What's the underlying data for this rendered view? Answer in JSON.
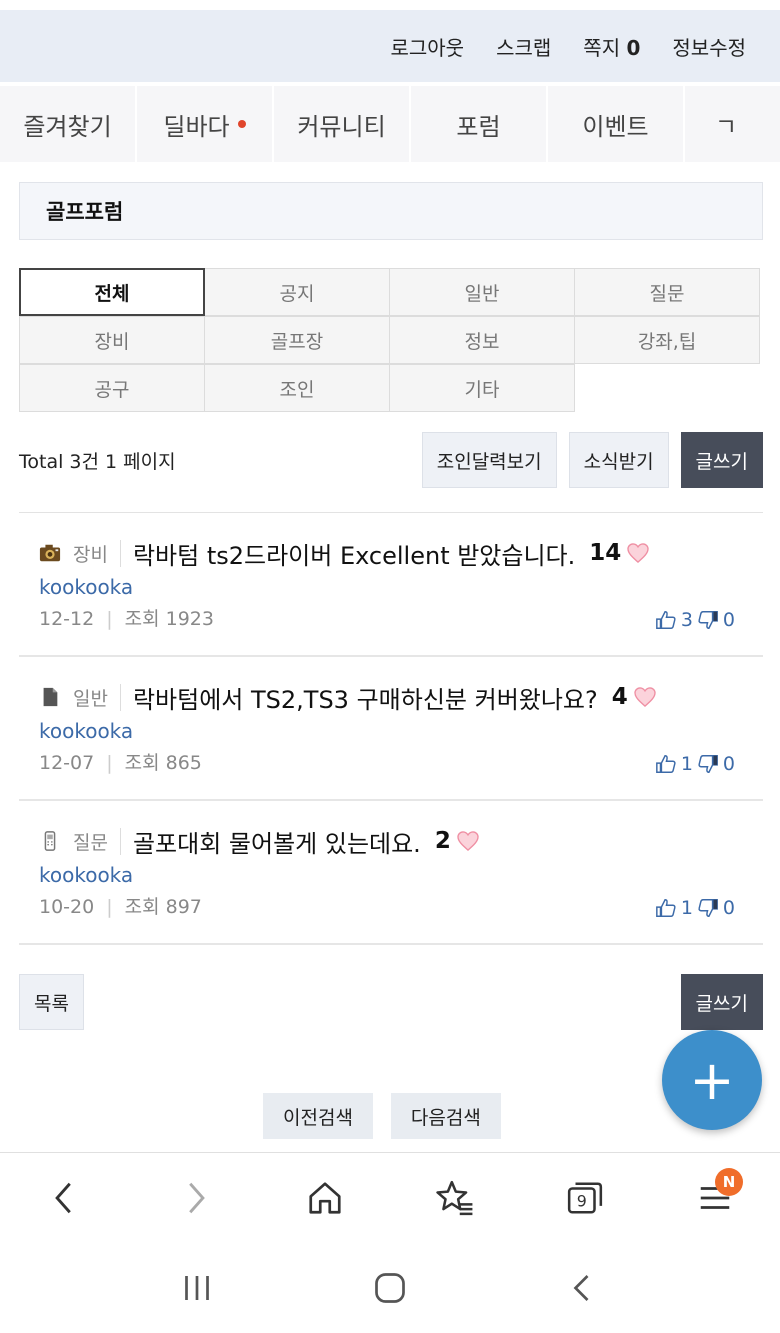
{
  "top_links": {
    "logout": "로그아웃",
    "scrap": "스크랩",
    "memo": "쪽지",
    "memo_count": "0",
    "edit_info": "정보수정"
  },
  "nav_tabs": [
    "즐겨찾기",
    "딜바다",
    "커뮤니티",
    "포럼",
    "이벤트",
    "ㄱ"
  ],
  "board": {
    "title": "골프포럼"
  },
  "categories": [
    [
      "전체",
      "공지",
      "일반",
      "질문"
    ],
    [
      "장비",
      "골프장",
      "정보",
      "강좌,팁"
    ],
    [
      "공구",
      "조인",
      "기타"
    ]
  ],
  "toolbar": {
    "total": "Total 3건 1 페이지",
    "join_calendar": "조인달력보기",
    "subscribe": "소식받기",
    "write": "글쓰기"
  },
  "posts": [
    {
      "icon": "camera-icon",
      "category": "장비",
      "title": "락바텀 ts2드라이버 Excellent 받았습니다.",
      "count": "14",
      "author": "kookooka",
      "date": "12-12",
      "views": "조회 1923",
      "likes": "3",
      "dislikes": "0"
    },
    {
      "icon": "document-icon",
      "category": "일반",
      "title": "락바텀에서 TS2,TS3 구매하신분 커버왔나요?",
      "count": "4",
      "author": "kookooka",
      "date": "12-07",
      "views": "조회 865",
      "likes": "1",
      "dislikes": "0"
    },
    {
      "icon": "phone-icon",
      "category": "질문",
      "title": "골포대회 물어볼게 있는데요.",
      "count": "2",
      "author": "kookooka",
      "date": "10-20",
      "views": "조회 897",
      "likes": "1",
      "dislikes": "0"
    }
  ],
  "bottom": {
    "list": "목록",
    "write": "글쓰기",
    "prev_search": "이전검색",
    "next_search": "다음검색"
  },
  "fab": {
    "label": "+"
  },
  "browser": {
    "tabs_count": "9",
    "menu_badge": "N"
  },
  "colors": {
    "accent": "#3d8fcb",
    "dark_button": "#474d5a",
    "author": "#3c6aa8",
    "badge": "#f06d2a"
  }
}
